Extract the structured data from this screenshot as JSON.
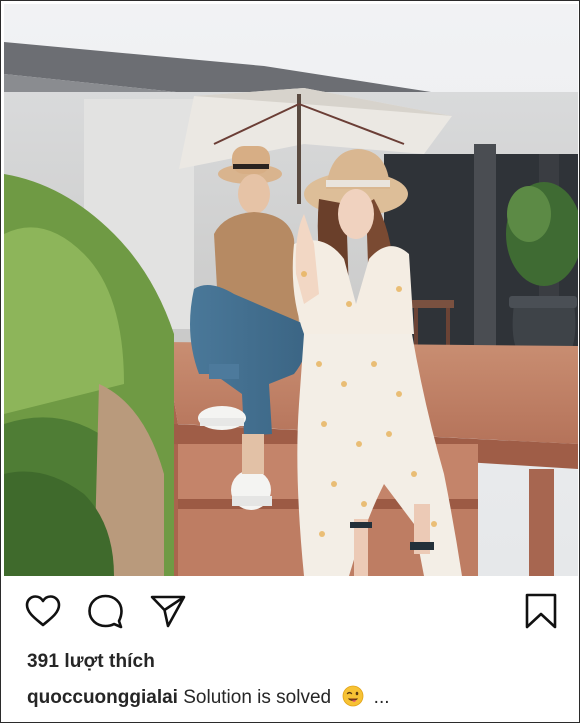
{
  "post": {
    "likes_text": "391 lượt thích",
    "username": "quoccuonggialai",
    "caption_text": "Solution is solved",
    "more_text": "...",
    "emoji": "winking-face-with-tongue"
  },
  "actions": {
    "icons": [
      "heart-icon",
      "comment-icon",
      "share-icon",
      "bookmark-icon"
    ]
  },
  "colors": {
    "icon_stroke": "#111111",
    "text": "#262626",
    "border": "#2b2b2b"
  }
}
